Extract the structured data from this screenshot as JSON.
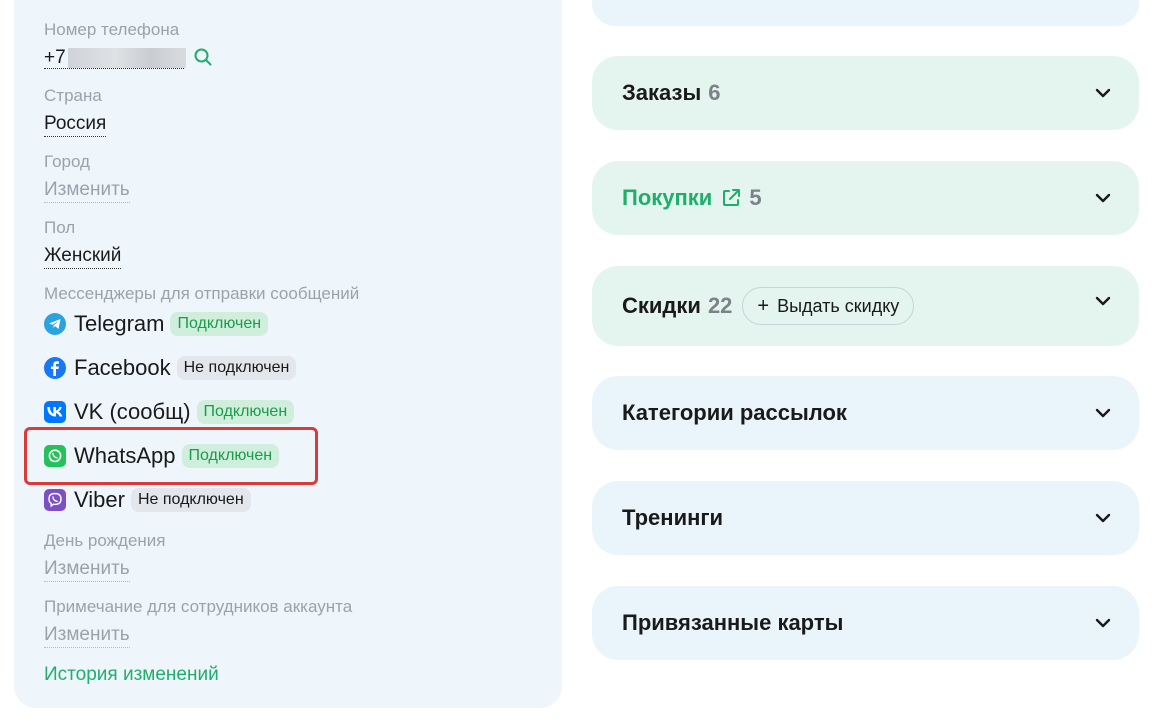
{
  "profile": {
    "phone": {
      "label": "Номер телефона",
      "prefix": "+7"
    },
    "country": {
      "label": "Страна",
      "value": "Россия"
    },
    "city": {
      "label": "Город",
      "value": "Изменить"
    },
    "gender": {
      "label": "Пол",
      "value": "Женский"
    },
    "messengers": {
      "label": "Мессенджеры для отправки сообщений",
      "items": [
        {
          "name": "Telegram",
          "status": "Подключен",
          "icon": "telegram-icon",
          "color": "#2aa3e0"
        },
        {
          "name": "Facebook",
          "status": "Не подключен",
          "icon": "facebook-icon",
          "color": "#1877f2"
        },
        {
          "name": "VK (сообщ)",
          "status": "Подключен",
          "icon": "vk-icon",
          "color": "#0077ff"
        },
        {
          "name": "WhatsApp",
          "status": "Подключен",
          "icon": "whatsapp-icon",
          "color": "#25c15a"
        },
        {
          "name": "Viber",
          "status": "Не подключен",
          "icon": "viber-icon",
          "color": "#7d4fc6"
        }
      ]
    },
    "birthday": {
      "label": "День рождения",
      "value": "Изменить"
    },
    "staff_note": {
      "label": "Примечание для сотрудников аккаунта",
      "value": "Изменить"
    },
    "history_link": "История изменений"
  },
  "sections": {
    "orders": {
      "title": "Заказы",
      "count": "6"
    },
    "purchases": {
      "title": "Покупки",
      "count": "5"
    },
    "discounts": {
      "title": "Скидки",
      "count": "22",
      "button": "Выдать скидку"
    },
    "mailing": {
      "title": "Категории рассылок"
    },
    "trainings": {
      "title": "Тренинги"
    },
    "cards": {
      "title": "Привязанные карты"
    }
  },
  "colors": {
    "accent_green": "#1fae6c",
    "highlight_red": "#d93a3a"
  }
}
